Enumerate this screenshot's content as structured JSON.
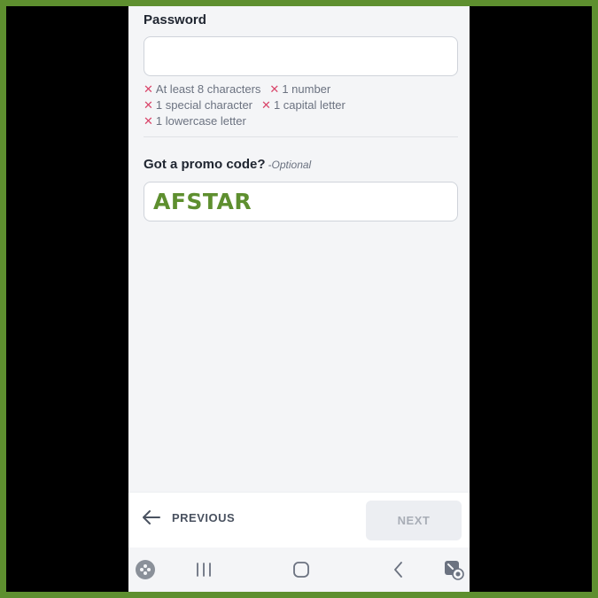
{
  "form": {
    "password_label": "Password",
    "password_value": "",
    "rules": [
      [
        "At least 8 characters",
        "1 number"
      ],
      [
        "1 special character",
        "1 capital letter"
      ],
      [
        "1 lowercase letter"
      ]
    ],
    "promo_label": "Got a promo code?",
    "promo_optional": "-Optional",
    "promo_value": "AFSTAR"
  },
  "actions": {
    "previous_label": "PREVIOUS",
    "next_label": "NEXT"
  },
  "colors": {
    "frame": "#5e8f2f",
    "promo_text": "#5e8f2f",
    "rule_x": "#d9456a"
  },
  "icons": {
    "rule": "close-icon",
    "previous": "arrow-left-icon",
    "navbar": [
      "game-launcher-icon",
      "recent-apps-icon",
      "home-icon",
      "back-icon",
      "screen-capture-icon"
    ]
  }
}
